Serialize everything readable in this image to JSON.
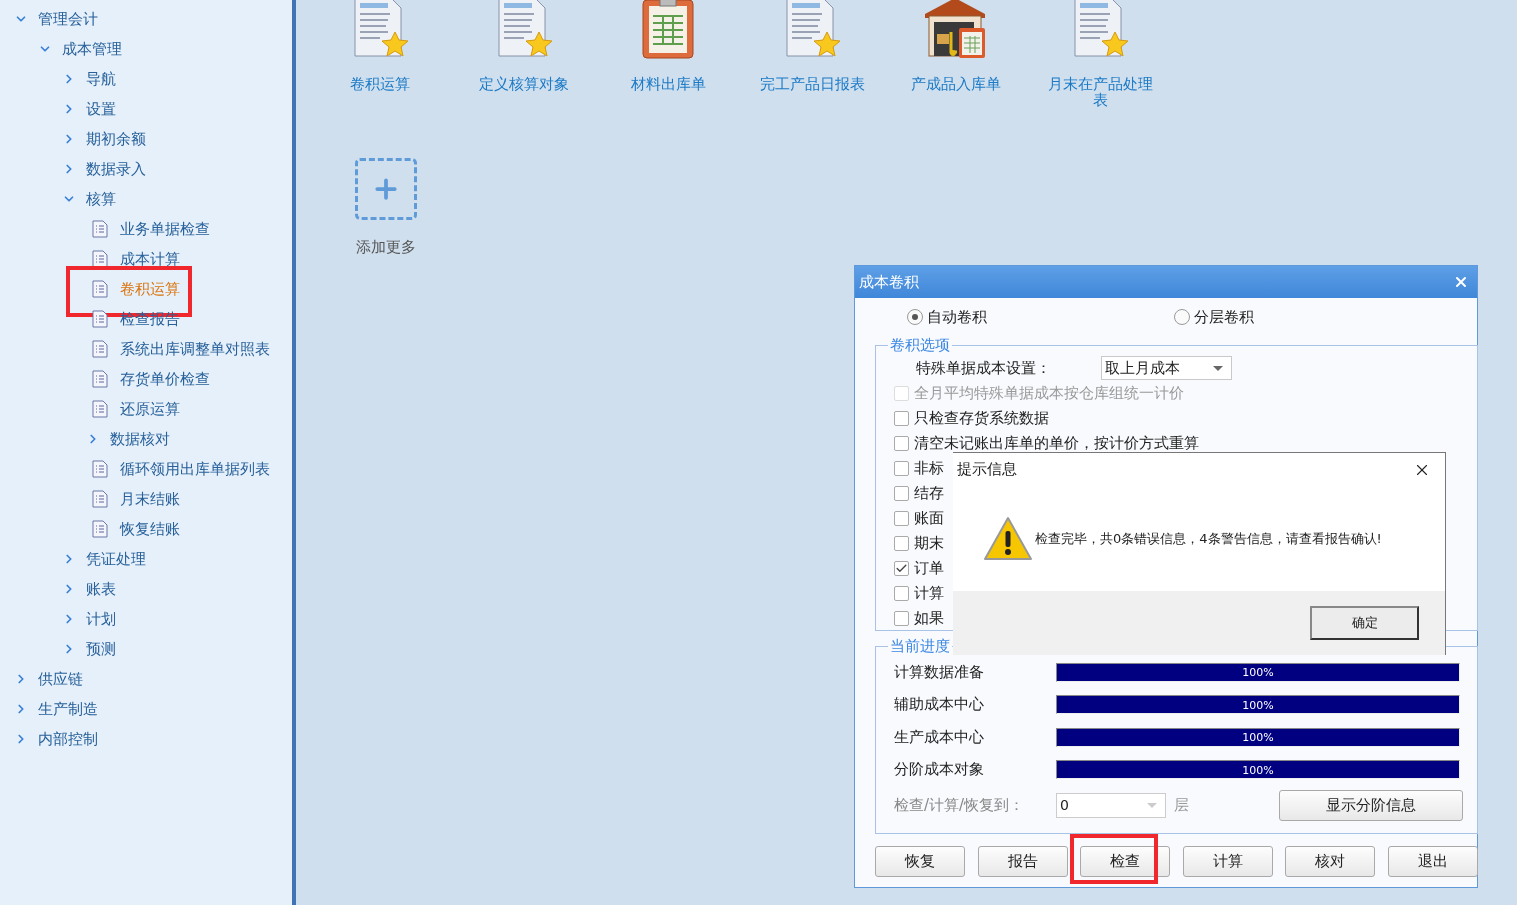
{
  "sidebar": {
    "tree": [
      {
        "label": "管理会计",
        "kind": "folder",
        "expanded": true,
        "selected": false,
        "children": [
          {
            "label": "成本管理",
            "kind": "folder",
            "expanded": true,
            "selected": false,
            "children": [
              {
                "label": "导航",
                "kind": "folder",
                "expanded": false,
                "selected": false
              },
              {
                "label": "设置",
                "kind": "folder",
                "expanded": false,
                "selected": false
              },
              {
                "label": "期初余额",
                "kind": "folder",
                "expanded": false,
                "selected": false
              },
              {
                "label": "数据录入",
                "kind": "folder",
                "expanded": false,
                "selected": false
              },
              {
                "label": "核算",
                "kind": "folder",
                "expanded": true,
                "selected": false,
                "children": [
                  {
                    "label": "业务单据检查",
                    "kind": "page",
                    "selected": false,
                    "highlighted": false
                  },
                  {
                    "label": "成本计算",
                    "kind": "page",
                    "selected": false,
                    "highlighted": false
                  },
                  {
                    "label": "卷积运算",
                    "kind": "page",
                    "selected": true,
                    "highlighted": true
                  },
                  {
                    "label": "检查报告",
                    "kind": "page",
                    "selected": false,
                    "highlighted": false
                  },
                  {
                    "label": "系统出库调整单对照表",
                    "kind": "page",
                    "selected": false,
                    "highlighted": false
                  },
                  {
                    "label": "存货单价检查",
                    "kind": "page",
                    "selected": false,
                    "highlighted": false
                  },
                  {
                    "label": "还原运算",
                    "kind": "page",
                    "selected": false,
                    "highlighted": false
                  },
                  {
                    "label": "数据核对",
                    "kind": "folder",
                    "expanded": false,
                    "selected": false
                  },
                  {
                    "label": "循环领用出库单据列表",
                    "kind": "page",
                    "selected": false,
                    "highlighted": false
                  },
                  {
                    "label": "月末结账",
                    "kind": "page",
                    "selected": false,
                    "highlighted": false
                  },
                  {
                    "label": "恢复结账",
                    "kind": "page",
                    "selected": false,
                    "highlighted": false
                  }
                ]
              },
              {
                "label": "凭证处理",
                "kind": "folder",
                "expanded": false,
                "selected": false
              },
              {
                "label": "账表",
                "kind": "folder",
                "expanded": false,
                "selected": false
              },
              {
                "label": "计划",
                "kind": "folder",
                "expanded": false,
                "selected": false
              },
              {
                "label": "预测",
                "kind": "folder",
                "expanded": false,
                "selected": false
              }
            ]
          }
        ]
      },
      {
        "label": "供应链",
        "kind": "folder",
        "expanded": false,
        "selected": false
      },
      {
        "label": "生产制造",
        "kind": "folder",
        "expanded": false,
        "selected": false
      },
      {
        "label": "内部控制",
        "kind": "folder",
        "expanded": false,
        "selected": false
      }
    ]
  },
  "shortcuts": [
    {
      "label": "卷积运算",
      "kind": "document"
    },
    {
      "label": "定义核算对象",
      "kind": "document"
    },
    {
      "label": "材料出库单",
      "kind": "clipboard"
    },
    {
      "label": "完工产品日报表",
      "kind": "document"
    },
    {
      "label": "产成品入库单",
      "kind": "warehouse"
    },
    {
      "label": "月末在产品处理表",
      "kind": "document"
    }
  ],
  "add_more": {
    "label": "添加更多"
  },
  "dialog": {
    "title": "成本卷积",
    "radios": [
      {
        "label": "自动卷积",
        "selected": true
      },
      {
        "label": "分层卷积",
        "selected": false
      }
    ],
    "options_group": {
      "title": "卷积选项",
      "special_cost": {
        "label": "特殊单据成本设置：",
        "value": "取上月成本"
      },
      "checkboxes": [
        {
          "label": "全月平均特殊单据成本按仓库组统一计价",
          "checked": false,
          "disabled": true
        },
        {
          "label": "只检查存货系统数据",
          "checked": false,
          "disabled": false
        },
        {
          "label": "清空未记账出库单的单价，按计价方式重算",
          "checked": false,
          "disabled": false
        },
        {
          "label": "非标",
          "checked": false,
          "disabled": false
        },
        {
          "label": "结存",
          "checked": false,
          "disabled": false
        },
        {
          "label": "账面",
          "checked": false,
          "disabled": false
        },
        {
          "label": "期末",
          "checked": false,
          "disabled": false
        },
        {
          "label": "订单",
          "checked": true,
          "disabled": false
        },
        {
          "label": "计算",
          "checked": false,
          "disabled": false
        },
        {
          "label": "如果",
          "checked": false,
          "disabled": false
        }
      ]
    },
    "progress_group": {
      "title": "当前进度",
      "rows": [
        {
          "label": "计算数据准备",
          "level": 1,
          "reading": "100%"
        },
        {
          "label": "辅助成本中心",
          "level": 1,
          "reading": "100%"
        },
        {
          "label": "生产成本中心",
          "level": 1,
          "reading": "100%"
        },
        {
          "label": "分阶成本对象",
          "level": 1,
          "reading": "100%"
        }
      ],
      "layer": {
        "label": "检查/计算/恢复到：",
        "value": "0",
        "unit": "层",
        "disabled": true
      },
      "detail_button": "显示分阶信息"
    },
    "buttons": [
      {
        "label": "恢复",
        "highlighted": false
      },
      {
        "label": "报告",
        "highlighted": false
      },
      {
        "label": "检查",
        "highlighted": true
      },
      {
        "label": "计算",
        "highlighted": false
      },
      {
        "label": "核对",
        "highlighted": false
      },
      {
        "label": "退出",
        "highlighted": false
      }
    ]
  },
  "message_box": {
    "title": "提示信息",
    "message": "检查完毕，共0条错误信息，4条警告信息，请查看报告确认!",
    "ok_button": "确定"
  }
}
